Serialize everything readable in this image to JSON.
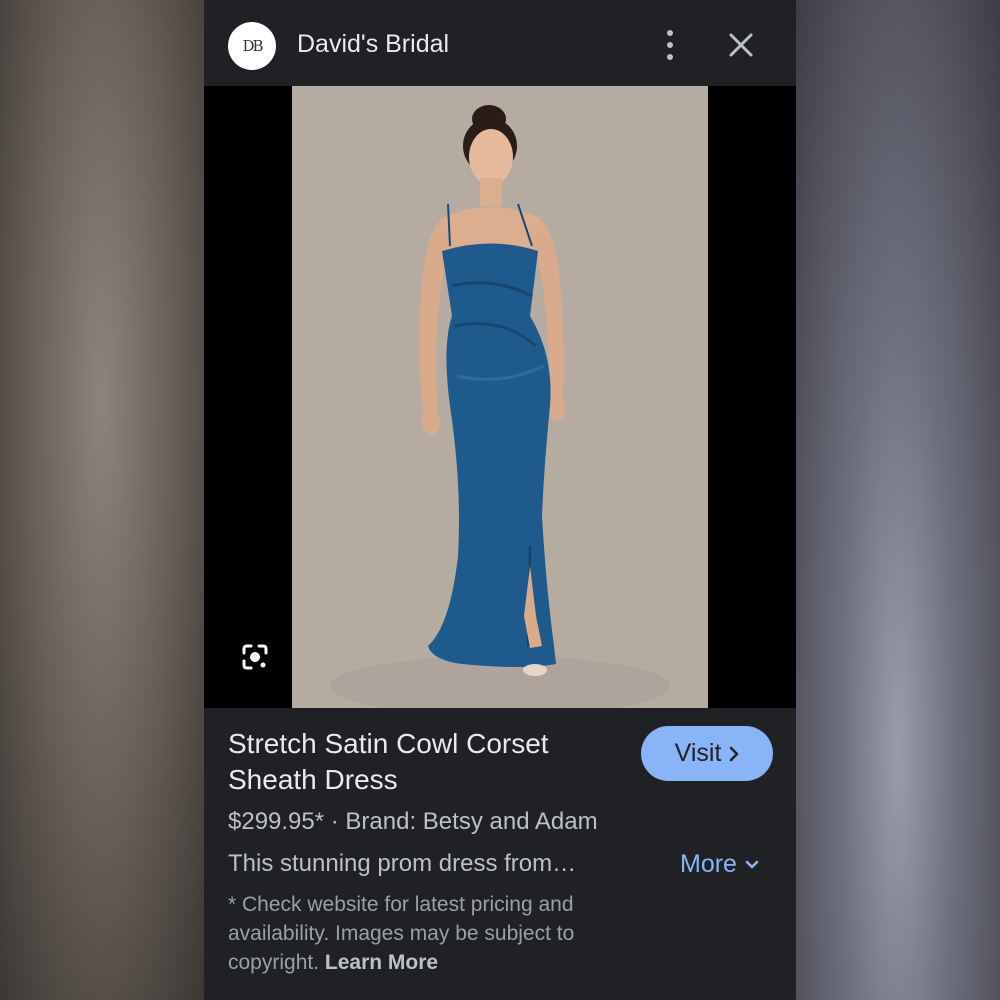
{
  "header": {
    "logo_text": "DB",
    "site_name": "David's Bridal",
    "menu_icon": "more-vert-icon",
    "close_icon": "close-icon"
  },
  "image": {
    "lens_icon": "google-lens-icon"
  },
  "product": {
    "title": "Stretch Satin Cowl Corset Sheath Dress",
    "price_line": "$299.95* · Brand: Betsy and Adam",
    "description": "This stunning prom dress from…",
    "visit_label": "Visit",
    "more_label": "More",
    "disclaimer": "* Check website for latest pricing and availability. Images may be subject to copyright.",
    "learn_more_label": "Learn More"
  },
  "colors": {
    "accent": "#8ab4f8",
    "background": "#202124",
    "dress": "#1f5a8c"
  }
}
